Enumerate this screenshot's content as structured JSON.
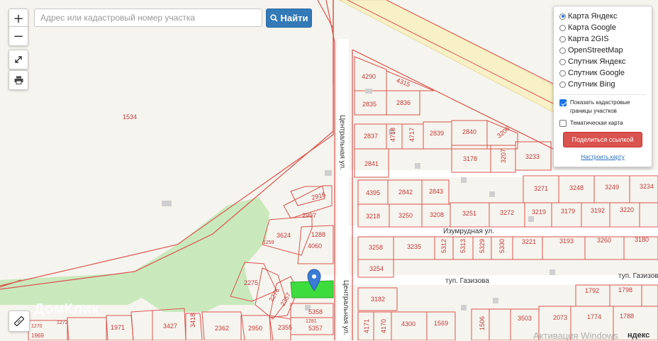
{
  "toolbar": {
    "zoom_in": "+",
    "zoom_out": "−",
    "search_placeholder": "Адрес или кадастровый номер участка",
    "search_value": "",
    "search_button": "Найти"
  },
  "layers": {
    "options": [
      "Карта Яндекс",
      "Карта Google",
      "Карта 2GIS",
      "OpenStreetMap",
      "Спутник Яндекс",
      "Спутник Google",
      "Спутник Bing"
    ],
    "selected": "Карта Яндекс",
    "show_cadastral": "Показать кадастровые границы участков",
    "show_cadastral_checked": true,
    "thematic": "Тематическая карта",
    "thematic_checked": false,
    "share_button": "Поделиться ссылкой",
    "configure_link": "Настроить карту"
  },
  "map": {
    "streets": {
      "central": "Центральная ул.",
      "central_2": "Центральная ул.",
      "izumrudnaya": "Изумрудная ул.",
      "gazizova": "туп. Газизова",
      "gazizova_2": "туп. Газизова"
    },
    "parcels": {
      "p1534": "1534",
      "p4290": "4290",
      "p4315": "4315",
      "p2835": "2835",
      "p2836": "2836",
      "p2837": "2837",
      "p4718": "4718",
      "p4717": "4717",
      "p2839": "2839",
      "p2840": "2840",
      "p3206": "3206",
      "p3178": "3178",
      "p3207": "3207",
      "p3233": "3233",
      "p2841": "2841",
      "p4395": "4395",
      "p2842": "2842",
      "p2843": "2843",
      "p3271": "3271",
      "p3248": "3248",
      "p3249": "3249",
      "p3234": "3234",
      "p3218": "3218",
      "p3250": "3250",
      "p3208": "3208",
      "p3251": "3251",
      "p3272": "3272",
      "p3219": "3219",
      "p3179": "3179",
      "p3192": "3192",
      "p3220": "3220",
      "p2916": "2916",
      "p2997": "2997",
      "p3624": "3624",
      "p1288": "1288",
      "p1259": "1259",
      "p4060": "4060",
      "p3258": "3258",
      "p3235": "3235",
      "p5312": "5312",
      "p5313": "5313",
      "p5329": "5329",
      "p5330": "5330",
      "p3221": "3221",
      "p3193": "3193",
      "p3260": "3260",
      "p3180": "3180",
      "p3254": "3254",
      "p2275": "2275",
      "p2276": "2276",
      "p2357": "2357",
      "p5358": "5358",
      "p1281": "1281",
      "p5357": "5357",
      "p3182": "3182",
      "p1792": "1792",
      "p1798": "1798",
      "p1774": "1774",
      "p1788": "1788",
      "p2073": "2073",
      "p3503": "3503",
      "p4171": "4171",
      "p4170": "4170",
      "p4300": "4300",
      "p1569": "1569",
      "p1506": "1506",
      "p1971": "1971",
      "p3427": "3427",
      "p3418": "3418",
      "p2362": "2362",
      "p2950": "2950",
      "p2355": "2355",
      "p1270": "1270",
      "p1272": "1272",
      "p1969": "1969"
    }
  },
  "overlay": {
    "watermark": "ДомКлик",
    "activation": "Активация Windows",
    "map_logo": "ндекс"
  },
  "colors": {
    "parcel_stroke": "#d9534f",
    "parcel_label": "#c23b3b",
    "green_area": "#c9e9bc",
    "selected_parcel": "#3ddc3d",
    "marker": "#3a7bd5",
    "road": "#ffffff",
    "highway": "#f8f1c6"
  }
}
